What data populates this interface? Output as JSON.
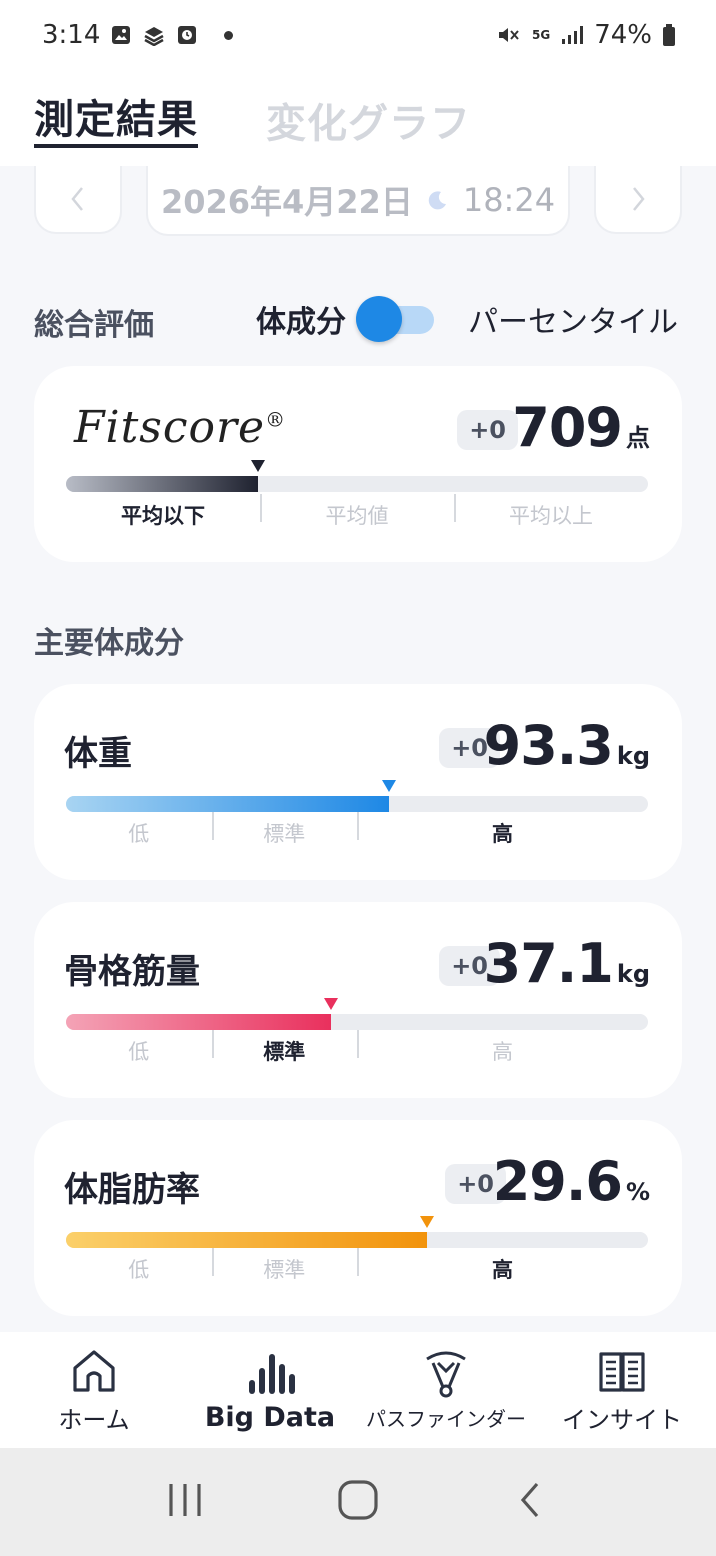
{
  "status_bar": {
    "time": "3:14",
    "network": "5G",
    "battery": "74%",
    "icons": [
      "image-icon",
      "app-icon",
      "clock-icon",
      "notification-dot",
      "mute-icon",
      "signal-icon",
      "battery-icon"
    ]
  },
  "tabs": {
    "results": "測定結果",
    "graph": "変化グラフ"
  },
  "date_nav": {
    "date": "2026年4月22日",
    "time": "18:24",
    "prev": "‹",
    "next": "›"
  },
  "overall": {
    "title": "総合評価",
    "toggle_left": "体成分",
    "toggle_right": "パーセンタイル"
  },
  "fitscore": {
    "logo": "Fitscore",
    "reg": "®",
    "delta": "+0",
    "value": "709",
    "unit": "点",
    "level": 0.33,
    "segments": [
      "平均以下",
      "平均値",
      "平均以上"
    ],
    "active_segment": 0
  },
  "body_section_title": "主要体成分",
  "metrics": [
    {
      "name": "体重",
      "delta": "+0",
      "value": "93.3",
      "unit": "kg",
      "level": 0.555,
      "color_start": "#a8d4f2",
      "color_end": "#1e88e5",
      "marker_color": "#1e88e5",
      "segments": [
        "低",
        "標準",
        "高"
      ],
      "active_segment": 2
    },
    {
      "name": "骨格筋量",
      "delta": "+0",
      "value": "37.1",
      "unit": "kg",
      "level": 0.455,
      "color_start": "#f4a3b6",
      "color_end": "#e9305d",
      "marker_color": "#e9305d",
      "segments": [
        "低",
        "標準",
        "高"
      ],
      "active_segment": 1
    },
    {
      "name": "体脂肪率",
      "delta": "+0",
      "value": "29.6",
      "unit": "%",
      "level": 0.62,
      "color_start": "#fbd06a",
      "color_end": "#f2930c",
      "marker_color": "#f2930c",
      "segments": [
        "低",
        "標準",
        "高"
      ],
      "active_segment": 2
    }
  ],
  "bottom_nav": {
    "home": "ホーム",
    "bigdata": "Big Data",
    "pathfinder": "パスファインダー",
    "insight": "インサイト"
  }
}
